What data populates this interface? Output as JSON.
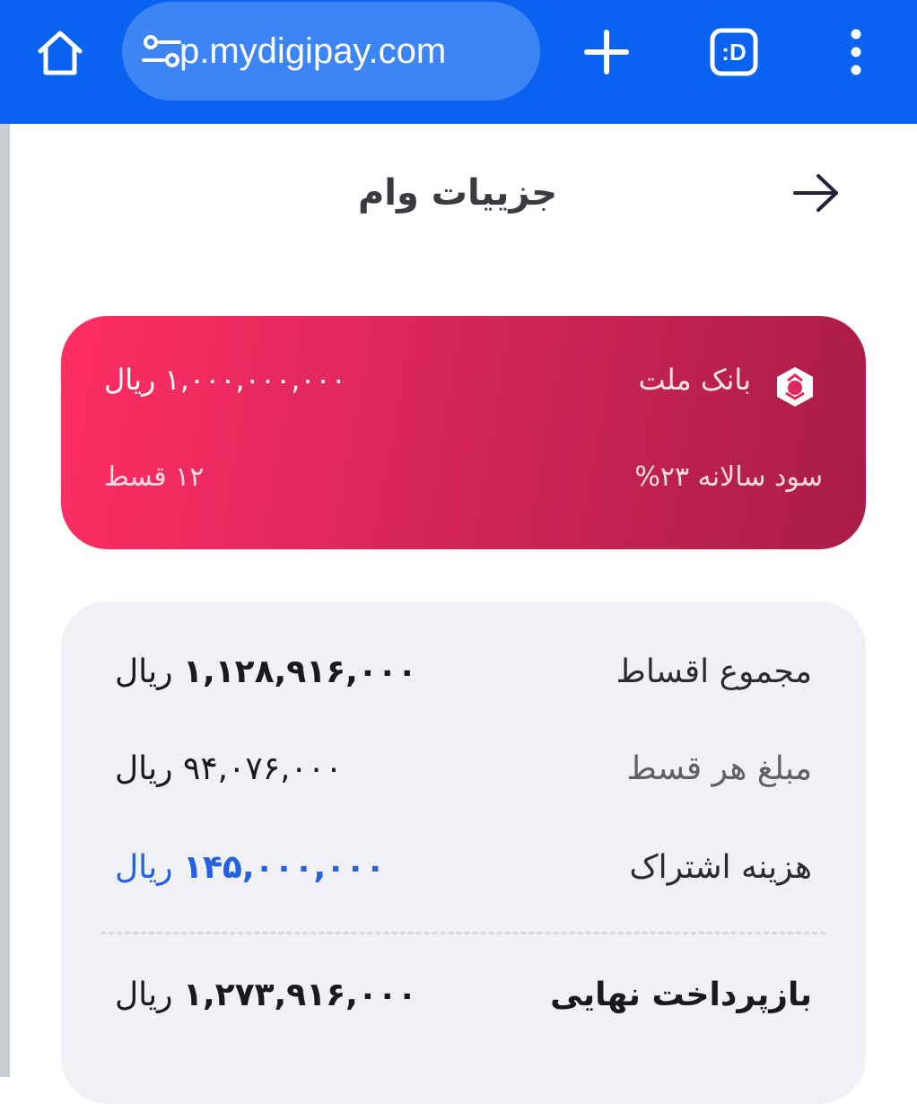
{
  "browser": {
    "url": "p.mydigipay.com",
    "icons": {
      "home": "home-icon",
      "site_settings": "tune-icon",
      "new_tab": "plus-icon",
      "tabs": "d-tab-icon",
      "menu": "more-vertical-icon"
    },
    "tab_badge": ":D"
  },
  "header": {
    "title": "جزییات وام",
    "back_icon": "arrow-right-icon"
  },
  "loan_card": {
    "bank_name": "بانک ملت",
    "bank_logo_icon": "bank-mellat-logo",
    "amount": "۱,۰۰۰,۰۰۰,۰۰۰ ریال",
    "interest": "سود سالانه ۲۳%",
    "installments": "۱۲ قسط"
  },
  "summary": {
    "rows": [
      {
        "label": "مجموع اقساط",
        "value": "۱,۱۲۸,۹۱۶,۰۰۰",
        "unit": "ریال"
      },
      {
        "label": "مبلغ هر قسط",
        "value": "۹۴,۰۷۶,۰۰۰",
        "unit": "ریال"
      },
      {
        "label": "هزینه اشتراک",
        "value": "۱۴۵,۰۰۰,۰۰۰",
        "unit": "ریال"
      }
    ],
    "total": {
      "label": "بازپرداخت نهایی",
      "value": "۱,۲۷۳,۹۱۶,۰۰۰",
      "unit": "ریال"
    }
  },
  "colors": {
    "browser_bar": "#0a62f0",
    "card_gradient_start": "#ff2e63",
    "card_gradient_end": "#a81d46",
    "accent_blue": "#2460e0"
  }
}
